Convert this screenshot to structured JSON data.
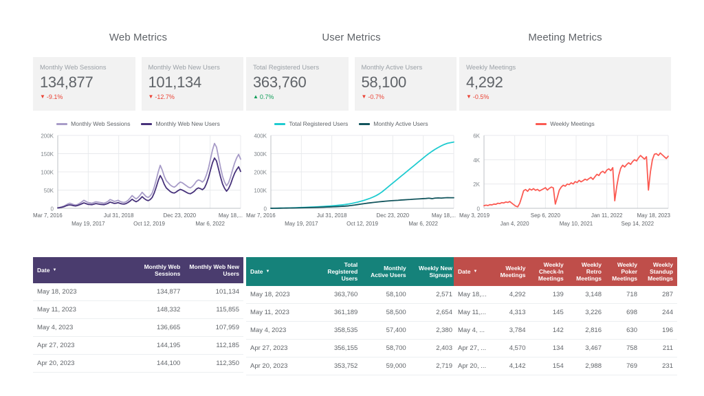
{
  "theme": {
    "page_bg": "#ffffff",
    "card_bg": "#f2f2f2",
    "text_gray": "#5f6368",
    "muted_gray": "#9aa0a6",
    "down_color": "#ea4335",
    "up_color": "#0f9d58",
    "web_header": "#4a3c6e",
    "user_header": "#15827a",
    "meeting_header": "#bf4e4a"
  },
  "panels": [
    {
      "id": "web",
      "title": "Web Metrics",
      "scorecards": [
        {
          "label": "Monthly Web Sessions",
          "value": "134,877",
          "delta": "-9.1%",
          "direction": "down",
          "arrow": "▼"
        },
        {
          "label": "Monthly Web New Users",
          "value": "101,134",
          "delta": "-12.7%",
          "direction": "down",
          "arrow": "▼"
        }
      ],
      "legend": [
        {
          "label": "Monthly Web Sessions",
          "color": "#a396c4"
        },
        {
          "label": "Monthly Web New Users",
          "color": "#473濃"
        }
      ]
    }
  ],
  "web": {
    "title": "Web Metrics",
    "scorecards": [
      {
        "label": "Monthly Web Sessions",
        "value": "134,877",
        "delta": "-9.1%",
        "direction": "down",
        "arrow": "▼"
      },
      {
        "label": "Monthly Web New Users",
        "value": "101,134",
        "delta": "-12.7%",
        "direction": "down",
        "arrow": "▼"
      }
    ],
    "legend": [
      {
        "label": "Monthly Web Sessions",
        "color": "#a89cc8"
      },
      {
        "label": "Monthly Web New Users",
        "color": "#46317a"
      }
    ],
    "table": {
      "header_color": "#4a3c6e",
      "columns": [
        "Date",
        "Monthly Web Sessions",
        "Monthly Web New Users"
      ],
      "sort_column": "Date",
      "sort_icon": "▼",
      "rows": [
        [
          "May 18, 2023",
          "134,877",
          "101,134"
        ],
        [
          "May 11, 2023",
          "148,332",
          "115,855"
        ],
        [
          "May 4, 2023",
          "136,665",
          "107,959"
        ],
        [
          "Apr 27, 2023",
          "144,195",
          "112,185"
        ],
        [
          "Apr 20, 2023",
          "144,100",
          "112,350"
        ]
      ]
    }
  },
  "user": {
    "title": "User Metrics",
    "scorecards": [
      {
        "label": "Total Registered Users",
        "value": "363,760",
        "delta": "0.7%",
        "direction": "up",
        "arrow": "▲"
      },
      {
        "label": "Monthly Active Users",
        "value": "58,100",
        "delta": "-0.7%",
        "direction": "down",
        "arrow": "▼"
      }
    ],
    "legend": [
      {
        "label": "Total Registered Users",
        "color": "#1ecbd0"
      },
      {
        "label": "Monthly Active Users",
        "color": "#11545c"
      }
    ],
    "table": {
      "header_color": "#15827a",
      "columns": [
        "Date",
        "Total Registered Users",
        "Monthly Active Users",
        "Weekly New Signups"
      ],
      "sort_column": "Date",
      "sort_icon": "▼",
      "rows": [
        [
          "May 18, 2023",
          "363,760",
          "58,100",
          "2,571"
        ],
        [
          "May 11, 2023",
          "361,189",
          "58,500",
          "2,654"
        ],
        [
          "May 4, 2023",
          "358,535",
          "57,400",
          "2,380"
        ],
        [
          "Apr 27, 2023",
          "356,155",
          "58,700",
          "2,403"
        ],
        [
          "Apr 20, 2023",
          "353,752",
          "59,000",
          "2,719"
        ]
      ]
    }
  },
  "meeting": {
    "title": "Meeting Metrics",
    "scorecards": [
      {
        "label": "Weekly Meetings",
        "value": "4,292",
        "delta": "-0.5%",
        "direction": "down",
        "arrow": "▼"
      }
    ],
    "legend": [
      {
        "label": "Weekly Meetings",
        "color": "#fb5a52"
      }
    ],
    "table": {
      "header_color": "#bf4e4a",
      "columns": [
        "Date",
        "Weekly Meetings",
        "Weekly Check-In Meetings",
        "Weekly Retro Meetings",
        "Weekly Poker Meetings",
        "Weekly Standup Meetings"
      ],
      "sort_column": "Date",
      "sort_icon": "▼",
      "rows": [
        [
          "May 18,...",
          "4,292",
          "139",
          "3,148",
          "718",
          "287"
        ],
        [
          "May 11,...",
          "4,313",
          "145",
          "3,226",
          "698",
          "244"
        ],
        [
          "May 4, ...",
          "3,784",
          "142",
          "2,816",
          "630",
          "196"
        ],
        [
          "Apr 27, ...",
          "4,570",
          "134",
          "3,467",
          "758",
          "211"
        ],
        [
          "Apr 20, ...",
          "4,142",
          "154",
          "2,988",
          "769",
          "231"
        ]
      ]
    }
  },
  "chart_data": [
    {
      "type": "line",
      "title": "Web Metrics",
      "xlabel": "",
      "ylabel": "",
      "ylim": [
        0,
        200000
      ],
      "yticks": [
        0,
        50000,
        100000,
        150000,
        200000
      ],
      "ytick_labels": [
        "0",
        "50K",
        "100K",
        "150K",
        "200K"
      ],
      "grid": true,
      "legend_position": "top",
      "xtick_labels_row1": [
        "Mar 7, 2016",
        "Jul 31, 2018",
        "Dec 23, 2020",
        "May 18,..."
      ],
      "xtick_labels_row2": [
        "May 19, 2017",
        "Oct 12, 2019",
        "Mar 6, 2022"
      ],
      "x": [
        "Mar 7, 2016",
        "May 19, 2017",
        "Jul 31, 2018",
        "Oct 12, 2019",
        "Dec 23, 2020",
        "Mar 6, 2022",
        "May 18, 2023"
      ],
      "series": [
        {
          "name": "Monthly Web Sessions",
          "color": "#a89cc8",
          "values": [
            1500,
            2500,
            4000,
            6000,
            9000,
            12000,
            14000,
            12000,
            10000,
            9000,
            11000,
            14000,
            18000,
            22000,
            19000,
            16000,
            15000,
            14000,
            16000,
            18000,
            17000,
            16000,
            15000,
            14000,
            16000,
            19000,
            24000,
            22000,
            19000,
            20000,
            22000,
            19000,
            17000,
            16000,
            18000,
            22000,
            28000,
            35000,
            30000,
            26000,
            30000,
            36000,
            44000,
            38000,
            32000,
            30000,
            34000,
            42000,
            58000,
            78000,
            100000,
            118000,
            105000,
            88000,
            76000,
            70000,
            64000,
            60000,
            58000,
            62000,
            68000,
            72000,
            70000,
            66000,
            62000,
            58000,
            56000,
            60000,
            66000,
            74000,
            78000,
            76000,
            72000,
            78000,
            92000,
            110000,
            135000,
            160000,
            178000,
            168000,
            140000,
            112000,
            88000,
            72000,
            62000,
            70000,
            86000,
            106000,
            124000,
            138000,
            148000,
            134877
          ],
          "latest_value": 134877,
          "max_value": 178000
        },
        {
          "name": "Monthly Web New Users",
          "color": "#46317a",
          "values": [
            1000,
            1800,
            2800,
            4200,
            6500,
            8500,
            9500,
            8500,
            7000,
            6500,
            8000,
            10000,
            12500,
            15000,
            13000,
            11000,
            10500,
            10000,
            11500,
            13000,
            12000,
            11000,
            10500,
            10000,
            11500,
            13500,
            17000,
            15500,
            13500,
            14000,
            15500,
            13500,
            12000,
            11500,
            13000,
            16000,
            20000,
            25000,
            21000,
            18000,
            21000,
            26000,
            32000,
            27000,
            23000,
            21000,
            24000,
            30000,
            42000,
            58000,
            76000,
            90000,
            80000,
            66000,
            56000,
            51000,
            46000,
            43000,
            42000,
            45000,
            49000,
            52000,
            50000,
            47000,
            44000,
            41000,
            40000,
            43000,
            47000,
            53000,
            56000,
            54000,
            51000,
            56000,
            68000,
            84000,
            105000,
            125000,
            138000,
            130000,
            108000,
            86000,
            67000,
            55000,
            47000,
            54000,
            66000,
            82000,
            96000,
            106000,
            114000,
            101134
          ],
          "latest_value": 101134,
          "max_value": 138000
        }
      ]
    },
    {
      "type": "line",
      "title": "User Metrics",
      "xlabel": "",
      "ylabel": "",
      "ylim": [
        0,
        400000
      ],
      "yticks": [
        0,
        100000,
        200000,
        300000,
        400000
      ],
      "ytick_labels": [
        "0",
        "100K",
        "200K",
        "300K",
        "400K"
      ],
      "grid": true,
      "legend_position": "top",
      "xtick_labels_row1": [
        "Mar 7, 2016",
        "Jul 31, 2018",
        "Dec 23, 2020",
        "May 18,..."
      ],
      "xtick_labels_row2": [
        "May 19, 2017",
        "Oct 12, 2019",
        "Mar 6, 2022"
      ],
      "x": [
        "Mar 7, 2016",
        "May 19, 2017",
        "Jul 31, 2018",
        "Oct 12, 2019",
        "Dec 23, 2020",
        "Mar 6, 2022",
        "May 18, 2023"
      ],
      "series": [
        {
          "name": "Total Registered Users",
          "color": "#1ecbd0",
          "values": [
            300,
            500,
            800,
            1100,
            1500,
            1900,
            2400,
            2900,
            3400,
            4000,
            4600,
            5300,
            6000,
            6800,
            7600,
            8500,
            9400,
            10400,
            11500,
            12700,
            14000,
            15500,
            17200,
            19000,
            21000,
            23500,
            26500,
            30000,
            34000,
            38500,
            43500,
            49000,
            55000,
            62000,
            70000,
            80000,
            92000,
            106000,
            120000,
            134000,
            148000,
            162000,
            176000,
            190000,
            204000,
            218000,
            232000,
            246000,
            260000,
            274000,
            288000,
            301000,
            313000,
            324000,
            334000,
            343000,
            351000,
            357000,
            360500,
            363760
          ],
          "latest_value": 363760,
          "max_value": 363760
        },
        {
          "name": "Monthly Active Users",
          "color": "#11545c",
          "values": [
            200,
            350,
            500,
            700,
            900,
            1100,
            1400,
            1700,
            2000,
            2400,
            2800,
            3200,
            3700,
            4200,
            4700,
            5200,
            5800,
            6400,
            7000,
            7700,
            8400,
            9200,
            10000,
            11000,
            12000,
            13500,
            15500,
            18000,
            20500,
            23000,
            25500,
            28000,
            30000,
            32000,
            34000,
            36000,
            37500,
            39000,
            40500,
            42000,
            43000,
            44000,
            45500,
            46500,
            47500,
            48500,
            50000,
            51000,
            52000,
            53000,
            54000,
            55500,
            53000,
            56000,
            57000,
            56000,
            57500,
            58500,
            58000,
            58100
          ],
          "latest_value": 58100,
          "max_value": 59000
        }
      ]
    },
    {
      "type": "line",
      "title": "Meeting Metrics",
      "xlabel": "",
      "ylabel": "",
      "ylim": [
        0,
        6000
      ],
      "yticks": [
        0,
        2000,
        4000,
        6000
      ],
      "ytick_labels": [
        "0",
        "2K",
        "4K",
        "6K"
      ],
      "grid": true,
      "legend_position": "top",
      "xtick_labels_row1": [
        "May 3, 2019",
        "Sep 6, 2020",
        "Jan 11, 2022",
        "May 18, 2023"
      ],
      "xtick_labels_row2": [
        "Jan 4, 2020",
        "May 10, 2021",
        "Sep 14, 2022"
      ],
      "x": [
        "May 3, 2019",
        "Jan 4, 2020",
        "Sep 6, 2020",
        "May 10, 2021",
        "Jan 11, 2022",
        "Sep 14, 2022",
        "May 18, 2023"
      ],
      "series": [
        {
          "name": "Weekly Meetings",
          "color": "#fb5a52",
          "values": [
            210,
            260,
            230,
            300,
            280,
            350,
            330,
            420,
            390,
            470,
            440,
            520,
            480,
            560,
            430,
            300,
            180,
            120,
            400,
            900,
            1450,
            1550,
            1400,
            1600,
            1500,
            1620,
            1480,
            1560,
            1430,
            1520,
            1600,
            1700,
            1500,
            1650,
            1750,
            1680,
            350,
            900,
            1500,
            1750,
            1900,
            1820,
            2000,
            1950,
            2100,
            2000,
            2200,
            2120,
            2300,
            2180,
            2280,
            2400,
            2320,
            2450,
            2550,
            2380,
            2600,
            2800,
            2700,
            2950,
            3050,
            2900,
            3150,
            3250,
            3100,
            3350,
            620,
            1800,
            2700,
            3300,
            3550,
            3400,
            3600,
            3750,
            3620,
            3850,
            4000,
            3900,
            4150,
            4350,
            4200,
            4050,
            4250,
            1500,
            3000,
            4000,
            4450,
            4500,
            4350,
            4550,
            4400,
            4250,
            4100,
            4292
          ],
          "latest_value": 4292,
          "max_value": 4550
        }
      ]
    }
  ]
}
